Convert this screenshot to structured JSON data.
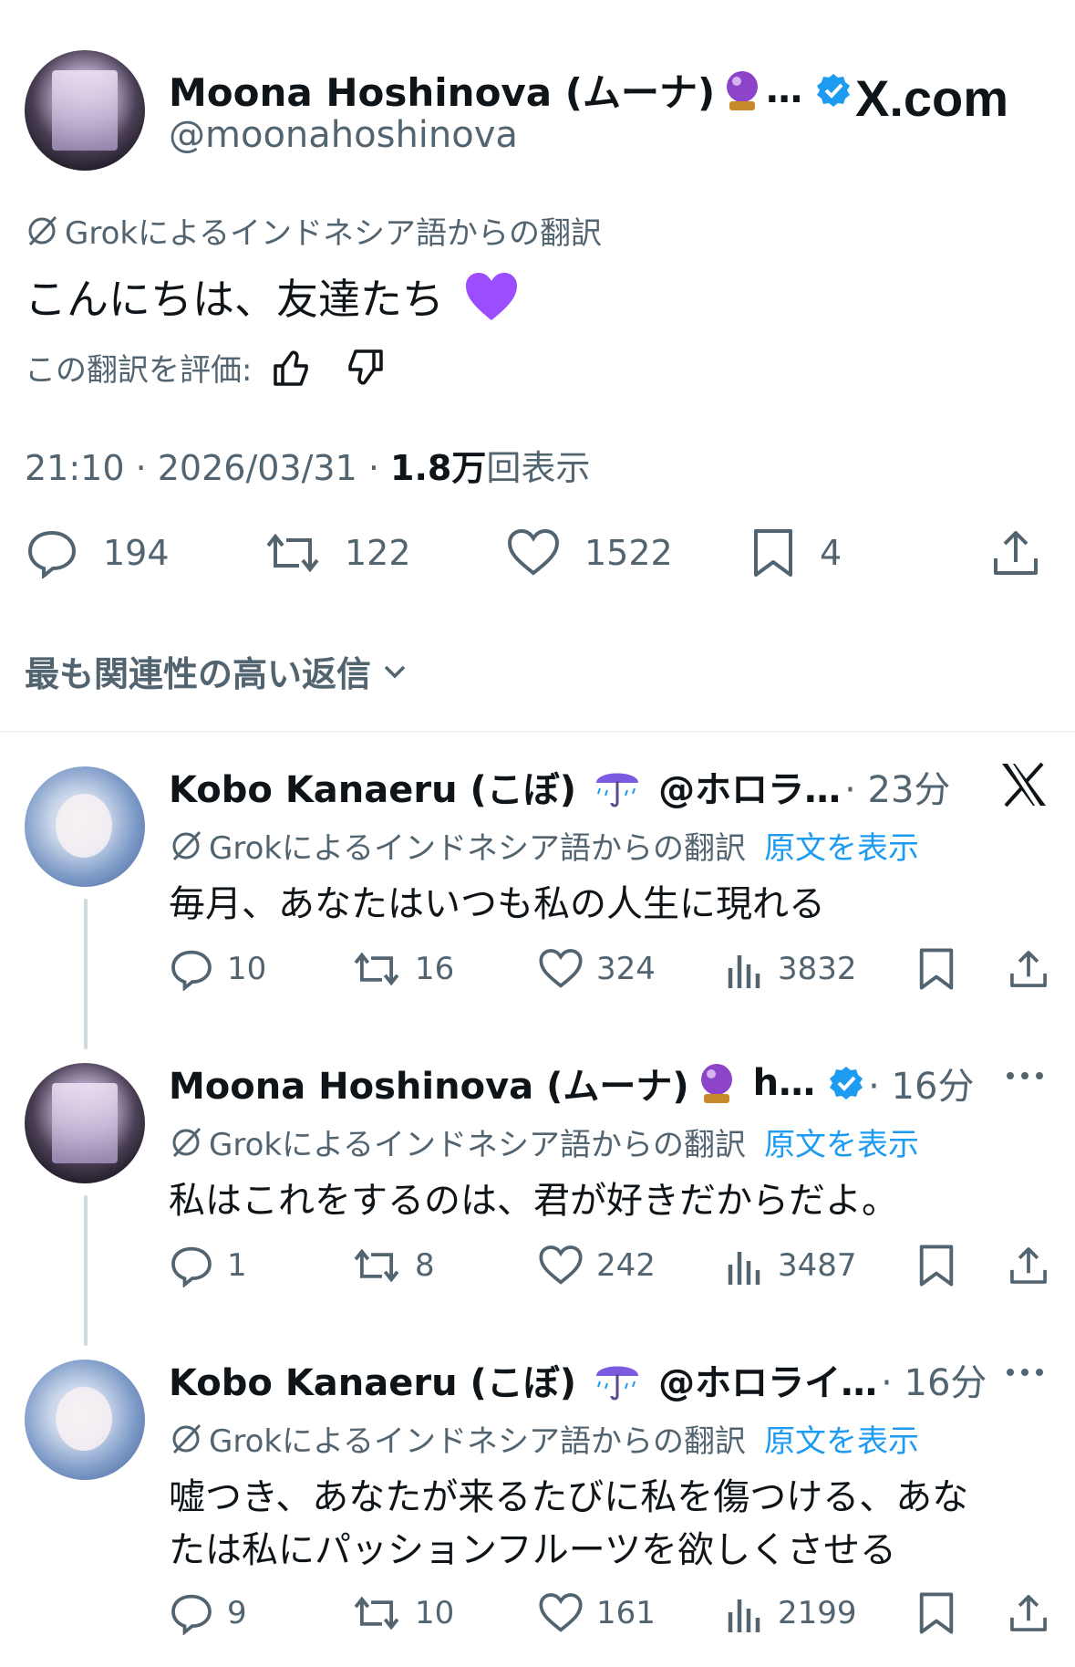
{
  "post": {
    "author_name": "Moona Hoshinova (ムーナ)",
    "author_ellipsis": "…",
    "handle": "@moonahoshinova",
    "brand": "X.com",
    "translation_note": "Grokによるインドネシア語からの翻訳",
    "text": "こんにちは、友達たち",
    "rate_label": "この翻訳を評価:",
    "time": "21:10 · 2026/03/31 · ",
    "views_count": "1.8万",
    "views_label": "回表示",
    "replies": "194",
    "reposts": "122",
    "likes": "1522",
    "bookmarks": "4"
  },
  "sort_label": "最も関連性の高い返信",
  "replies": [
    {
      "name": "Kobo Kanaeru (こぼ)",
      "handle": "@ホロラ…",
      "time": "· 23分",
      "translation_note": "Grokによるインドネシア語からの翻訳",
      "show_original": "原文を表示",
      "text": "毎月、あなたはいつも私の人生に現れる",
      "text2": "",
      "replies": "10",
      "reposts": "16",
      "likes": "324",
      "views": "3832"
    },
    {
      "name": "Moona Hoshinova (ムーナ)",
      "handle": "h…",
      "time": "· 16分",
      "translation_note": "Grokによるインドネシア語からの翻訳",
      "show_original": "原文を表示",
      "text": "私はこれをするのは、君が好きだからだよ。",
      "text2": "",
      "replies": "1",
      "reposts": "8",
      "likes": "242",
      "views": "3487"
    },
    {
      "name": "Kobo Kanaeru (こぼ)",
      "handle": "@ホロライ…",
      "time": "· 16分",
      "translation_note": "Grokによるインドネシア語からの翻訳",
      "show_original": "原文を表示",
      "text": "嘘つき、あなたが来るたびに私を傷つける、あな",
      "text2": "たは私にパッションフルーツを欲しくさせる",
      "replies": "9",
      "reposts": "10",
      "likes": "161",
      "views": "2199"
    }
  ],
  "colors": {
    "accent": "#1d9bf0",
    "text": "#0f1419",
    "muted": "#536471",
    "heart_emoji": "#9b4dff"
  }
}
